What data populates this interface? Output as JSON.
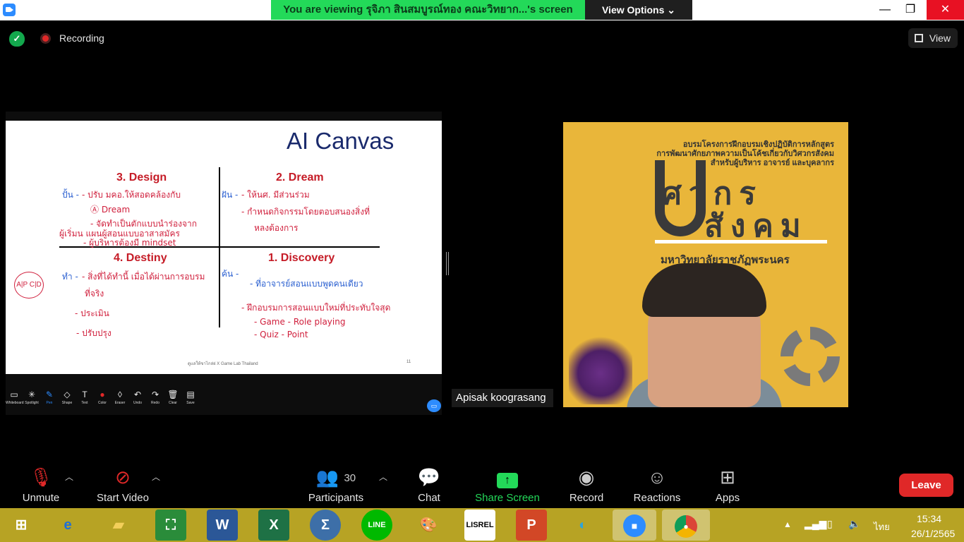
{
  "title_bar": {
    "banner": "You are viewing รุจิภา สินสมบูรณ์ทอง คณะวิทยาก...'s screen",
    "view_options": "View Options ⌄"
  },
  "status": {
    "recording": "Recording",
    "view": "View"
  },
  "slide": {
    "title": "AI Canvas",
    "quadrants": [
      "3. Design",
      "2. Dream",
      "4. Destiny",
      "1. Discovery"
    ],
    "footer": "ดูแลให้ขาไกล่ย่ X Game Lab Thailand",
    "page": "11",
    "handwriting": {
      "design_tag": "ปั้น -",
      "dream_tag": "ฝัน -",
      "destiny_tag": "ทำ -",
      "discovery_tag": "ค้น -",
      "design_1": "- ปรับ มคอ.ให้สอดคล้องกับ",
      "design_2": "Ⓐ Dream",
      "design_3": "- จัดทำเป็นตักแบบนำร่องจาก",
      "design_4": "ผู้เริ่มน แผนผู้สอนแบบอาสาสมัคร",
      "design_5": "- ผู้บริหารต้องมี mindset",
      "dream_1": "- ให้นศ. มีส่วนร่วม",
      "dream_2": "- กำหนดกิจกรรมโดยตอบสนองสิ่งที่",
      "dream_3": "หลงต้องการ",
      "destiny_1": "- สิ่งที่ได้ทำนี้ เมื่อได้ผ่านการอบรม",
      "destiny_2": "ที่จริง",
      "destiny_3": "- ประเมิน",
      "destiny_4": "- ปรับปรุง",
      "abcd": "A|P C|D",
      "discovery_1": "- ที่อาจารย์สอนแบบพูดคนเดียว",
      "discovery_2": "- ฝึกอบรมการสอนแบบใหม่ที่ประทับใจสุด",
      "discovery_3": "- Game   - Role playing",
      "discovery_4": "- Quiz   - Point"
    }
  },
  "annotation_toolbar": [
    "Whiteboard",
    "Spotlight",
    "Pen",
    "Shape",
    "Text",
    "Color",
    "Eraser",
    "Undo",
    "Redo",
    "Clear",
    "Save"
  ],
  "video": {
    "line1": "อบรมโครงการฝึกอบรมเชิงปฏิบัติการหลักสูตร",
    "line2": "การพัฒนาศักยภาพความเป็นโค้ชเกี่ยวกับวิศวกรสังคม",
    "line3": "สำหรับผู้บริหาร อาจารย์ และบุคลากร",
    "big1": "ศวกร",
    "big2": "สังคม",
    "university": "มหาวิทยาลัยราชภัฏพระนคร",
    "name": "Apisak koograsang"
  },
  "controls": {
    "unmute": "Unmute",
    "start_video": "Start Video",
    "participants": "Participants",
    "participants_count": "30",
    "chat": "Chat",
    "share_screen": "Share Screen",
    "record": "Record",
    "reactions": "Reactions",
    "apps": "Apps",
    "leave": "Leave"
  },
  "taskbar": {
    "ime": "ไทย",
    "time": "15:34",
    "date": "26/1/2565"
  },
  "colors": {
    "zoom_blue": "#2d8cff",
    "share_green": "#23d959",
    "leave_red": "#e02828",
    "taskbar": "#b7a324"
  }
}
